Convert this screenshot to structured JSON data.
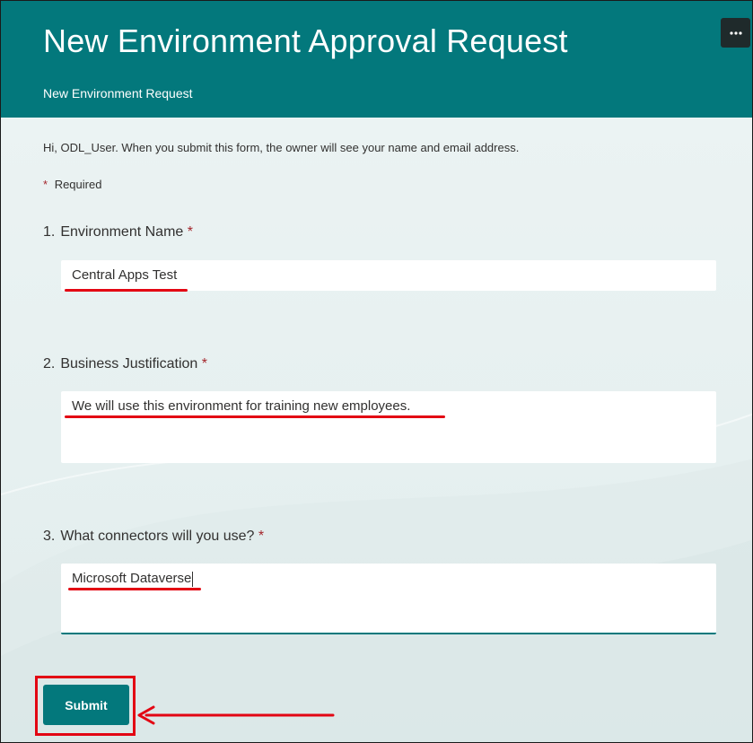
{
  "header": {
    "title": "New Environment Approval Request",
    "subtitle": "New Environment Request",
    "more_label": "···"
  },
  "intro_text": "Hi, ODL_User. When you submit this form, the owner will see your name and email address.",
  "required_note": {
    "star": "*",
    "text": "Required"
  },
  "questions": [
    {
      "number": "1.",
      "label": "Environment Name",
      "star": "*",
      "value": "Central Apps Test"
    },
    {
      "number": "2.",
      "label": "Business Justification",
      "star": "*",
      "value": "We will use this environment for training new employees."
    },
    {
      "number": "3.",
      "label": "What connectors will you use?",
      "star": "*",
      "value": "Microsoft Dataverse"
    }
  ],
  "submit_label": "Submit",
  "colors": {
    "header_bg": "#03787c",
    "annotation": "#e30613",
    "required_star": "#a4262c"
  },
  "icons": {
    "more": "more-horizontal-icon",
    "arrow": "arrow-left-icon"
  }
}
